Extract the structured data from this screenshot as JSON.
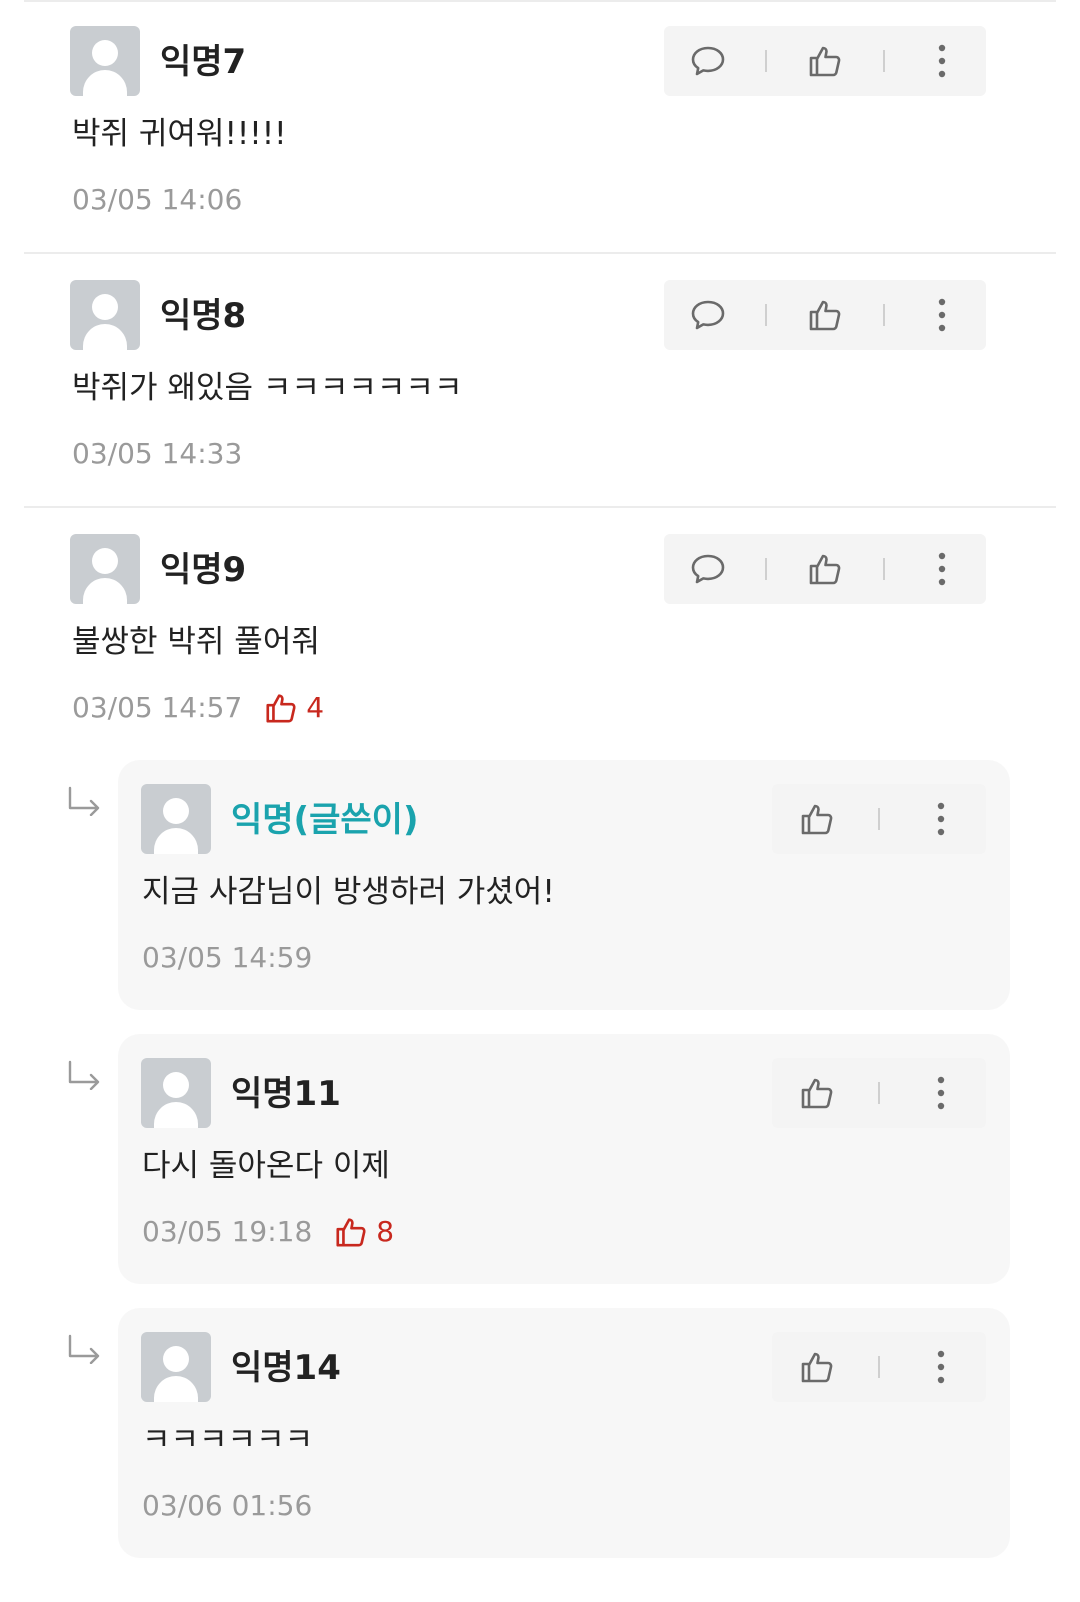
{
  "comments": [
    {
      "name": "익명7",
      "text": "박쥐 귀여워!!!!!",
      "time": "03/05 14:06"
    },
    {
      "name": "익명8",
      "text": "박쥐가 왜있음 ㅋㅋㅋㅋㅋㅋㅋ",
      "time": "03/05 14:33"
    },
    {
      "name": "익명9",
      "text": "불쌍한 박쥐 풀어줘",
      "time": "03/05 14:57",
      "likes": "4"
    }
  ],
  "replies": [
    {
      "name": "익명(글쓴이)",
      "text": "지금 사감님이 방생하러 가셨어!",
      "time": "03/05 14:59"
    },
    {
      "name": "익명11",
      "text": "다시 돌아온다 이제",
      "time": "03/05 19:18",
      "likes": "8"
    },
    {
      "name": "익명14",
      "text": "ㅋㅋㅋㅋㅋㅋ",
      "time": "03/06 01:56"
    }
  ],
  "colors": {
    "author": "#1aa3ad",
    "like": "#c8281e",
    "muted": "#9a9a9a"
  },
  "icons": {
    "reply": "speech-bubble-icon",
    "like": "thumbs-up-icon",
    "more": "kebab-menu-icon",
    "thread": "reply-arrow-icon"
  }
}
